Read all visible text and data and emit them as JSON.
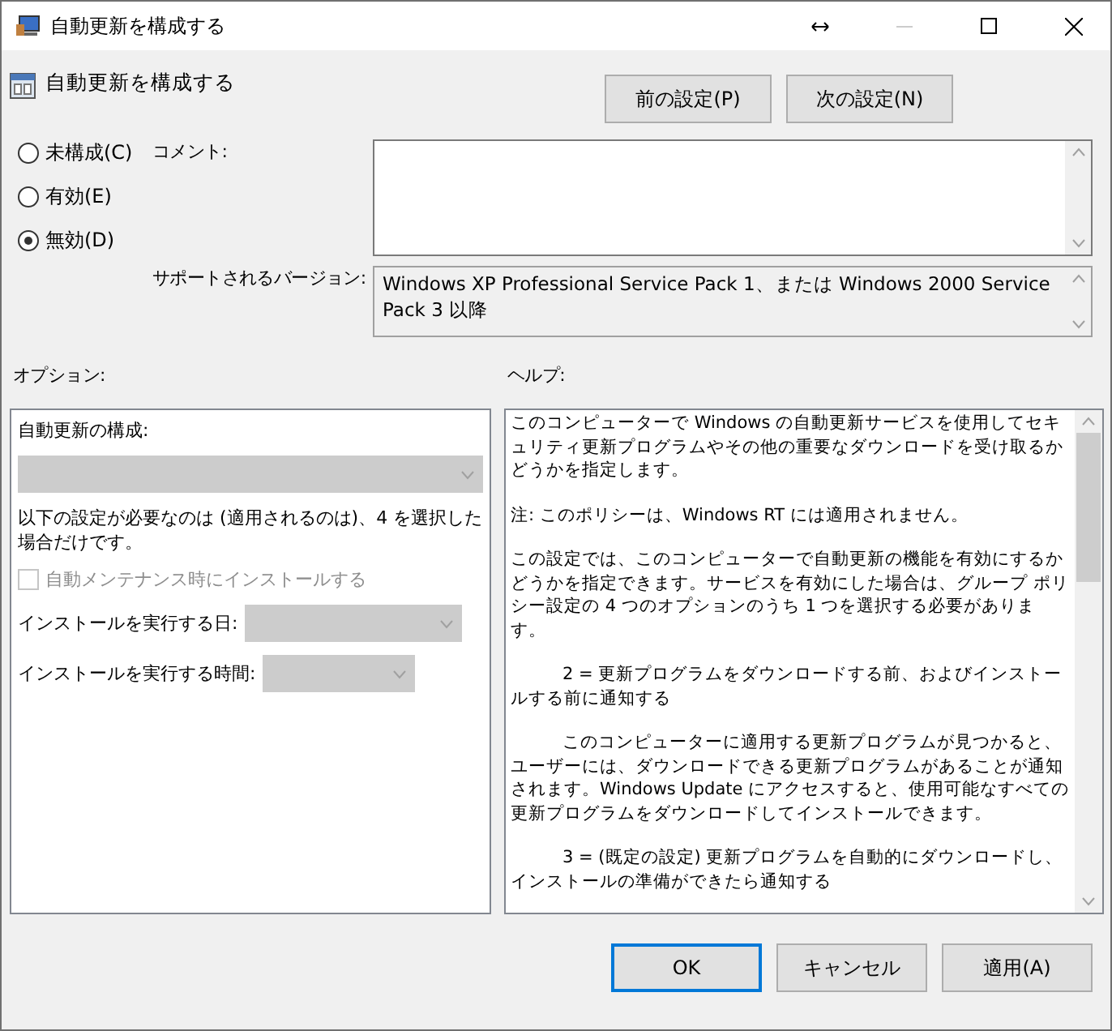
{
  "window": {
    "title": "自動更新を構成する"
  },
  "header": {
    "title": "自動更新を構成する"
  },
  "nav_buttons": [
    {
      "label": "前の設定(P)"
    },
    {
      "label": "次の設定(N)"
    }
  ],
  "state_options": [
    {
      "label": "未構成(C)",
      "selected": false
    },
    {
      "label": "有効(E)",
      "selected": false
    },
    {
      "label": "無効(D)",
      "selected": true
    }
  ],
  "comment": {
    "label": "コメント:"
  },
  "supported": {
    "label": "サポートされるバージョン:",
    "value": "Windows XP Professional Service Pack 1、または Windows 2000 Service Pack 3 以降"
  },
  "options": {
    "label": "オプション:",
    "items": [
      {
        "kind": "label",
        "text": "自動更新の構成:"
      },
      {
        "kind": "dropdown",
        "disabled": true
      },
      {
        "kind": "note",
        "text": "以下の設定が必要なのは (適用されるのは)、4 を選択した場合だけです。"
      },
      {
        "kind": "checkbox",
        "text": "自動メンテナンス時にインストールする",
        "checked": false,
        "disabled": true
      },
      {
        "kind": "labeled_dropdown",
        "text": "インストールを実行する日:",
        "disabled": true
      },
      {
        "kind": "labeled_dropdown",
        "text": "インストールを実行する時間:",
        "disabled": true
      }
    ]
  },
  "help": {
    "label": "ヘルプ:",
    "paragraphs": [
      {
        "kind": "plain",
        "text": "このコンピューターで Windows の自動更新サービスを使用してセキュリティ更新プログラムやその他の重要なダウンロードを受け取るかどうかを指定します。"
      },
      {
        "kind": "plain",
        "text": "注: このポリシーは、Windows RT には適用されません。"
      },
      {
        "kind": "plain",
        "text": "この設定では、このコンピューターで自動更新の機能を有効にするかどうかを指定できます。サービスを有効にした場合は、グループ ポリシー設定の 4 つのオプションのうち 1 つを選択する必要があります。"
      },
      {
        "kind": "indented",
        "text": "2 = 更新プログラムをダウンロードする前、およびインストールする前に通知する"
      },
      {
        "kind": "indented",
        "text": "このコンピューターに適用する更新プログラムが見つかると、ユーザーには、ダウンロードできる更新プログラムがあることが通知されます。Windows Update にアクセスすると、使用可能なすべての更新プログラムをダウンロードしてインストールできます。"
      },
      {
        "kind": "indented",
        "text": "3 = (既定の設定) 更新プログラムを自動的にダウンロードし、インストールの準備ができたら通知する"
      }
    ]
  },
  "footer_buttons": [
    {
      "label": "OK",
      "default": true
    },
    {
      "label": "キャンセル",
      "default": false
    },
    {
      "label": "適用(A)",
      "default": false
    }
  ]
}
